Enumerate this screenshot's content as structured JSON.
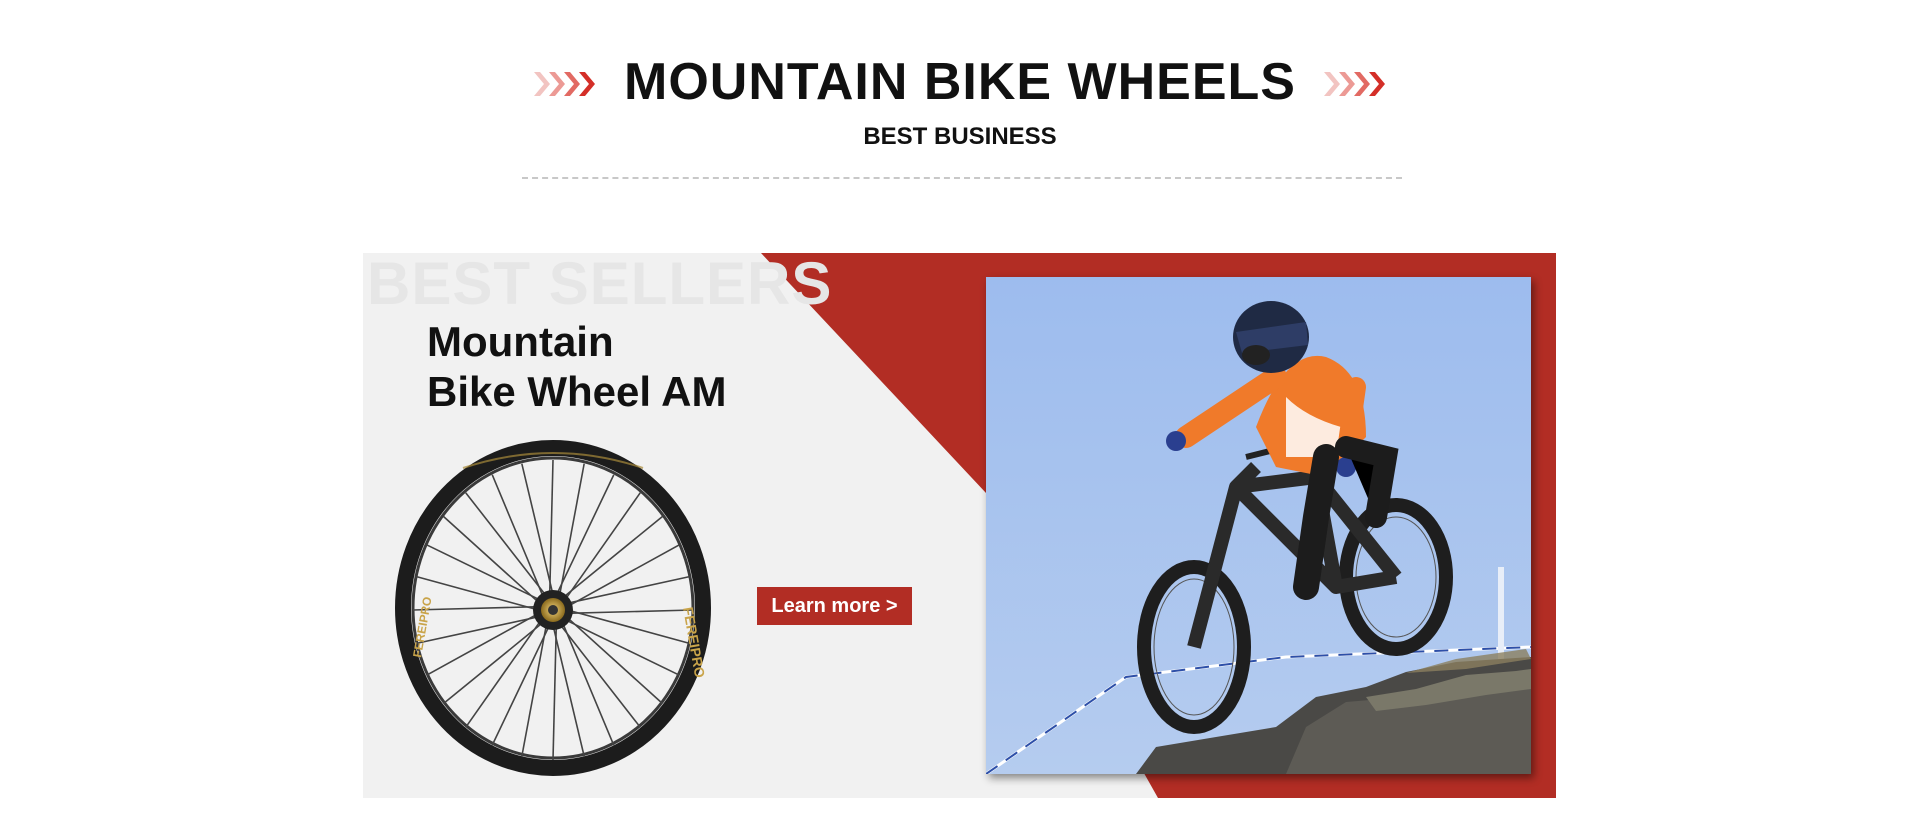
{
  "header": {
    "title": "MOUNTAIN BIKE WHEELS",
    "subtitle": "BEST BUSINESS"
  },
  "banner": {
    "watermark": "BEST SELLERS",
    "product_title_line1": "Mountain",
    "product_title_line2": "Bike Wheel AM",
    "cta_label": "Learn more >",
    "wheel_rim_text": "FEREIPRO"
  },
  "colors": {
    "accent_red": "#b22d24",
    "banner_bg": "#f1f1f1",
    "sky_blue": "#a7c3ef"
  },
  "icons": [
    "chevron-right-icon",
    "chevron-right-icon"
  ]
}
